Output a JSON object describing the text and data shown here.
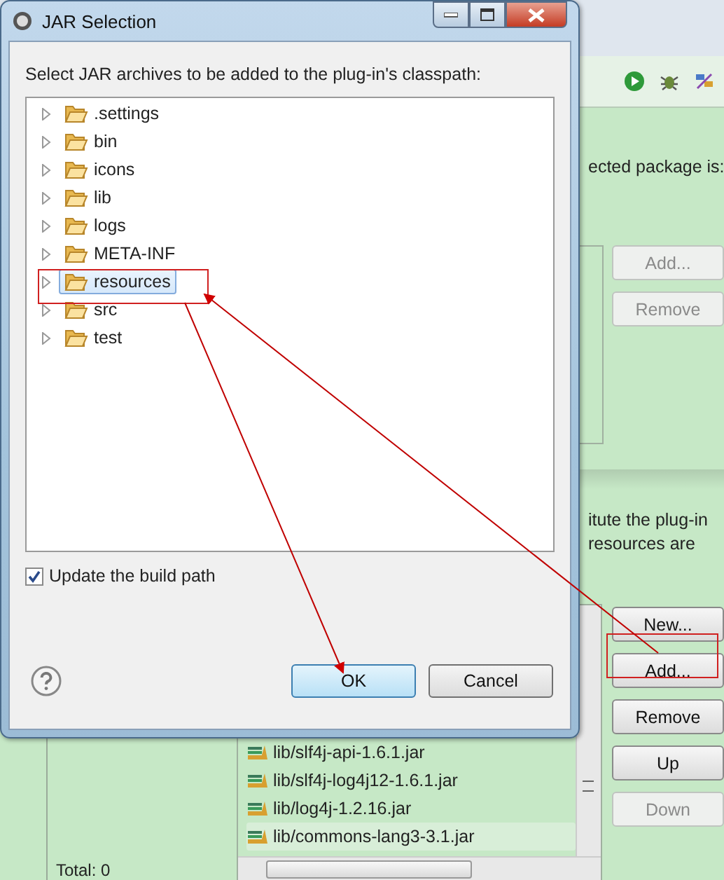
{
  "dialog": {
    "title": "JAR Selection",
    "message": "Select JAR archives to be added to the plug-in's classpath:",
    "tree": [
      {
        "label": ".settings",
        "expanded": false,
        "selected": false
      },
      {
        "label": "bin",
        "expanded": false,
        "selected": false
      },
      {
        "label": "icons",
        "expanded": false,
        "selected": false
      },
      {
        "label": "lib",
        "expanded": false,
        "selected": false
      },
      {
        "label": "logs",
        "expanded": false,
        "selected": false
      },
      {
        "label": "META-INF",
        "expanded": false,
        "selected": false
      },
      {
        "label": "resources",
        "expanded": false,
        "selected": true
      },
      {
        "label": "src",
        "expanded": false,
        "selected": false
      },
      {
        "label": "test",
        "expanded": false,
        "selected": false
      }
    ],
    "update_build_path": {
      "label": "Update the build path",
      "checked": true
    },
    "buttons": [
      {
        "label": "OK",
        "default": true
      },
      {
        "label": "Cancel",
        "default": false
      }
    ]
  },
  "background": {
    "package_text": "ected package is:",
    "package_buttons": [
      {
        "label": "Add...",
        "disabled": true
      },
      {
        "label": "Remove",
        "disabled": true
      }
    ],
    "classpath_text": [
      "itute the plug-in",
      "resources are"
    ],
    "libraries": [
      {
        "label": "lib/slf4j-api-1.6.1.jar",
        "selected": false
      },
      {
        "label": "lib/slf4j-log4j12-1.6.1.jar",
        "selected": false
      },
      {
        "label": "lib/log4j-1.2.16.jar",
        "selected": false
      },
      {
        "label": "lib/commons-lang3-3.1.jar",
        "selected": true
      }
    ],
    "classpath_buttons": [
      {
        "label": "New...",
        "disabled": false
      },
      {
        "label": "Add...",
        "disabled": false
      },
      {
        "label": "Remove",
        "disabled": false
      },
      {
        "label": "Up",
        "disabled": false
      },
      {
        "label": "Down",
        "disabled": true
      }
    ],
    "total": "Total: 0"
  }
}
